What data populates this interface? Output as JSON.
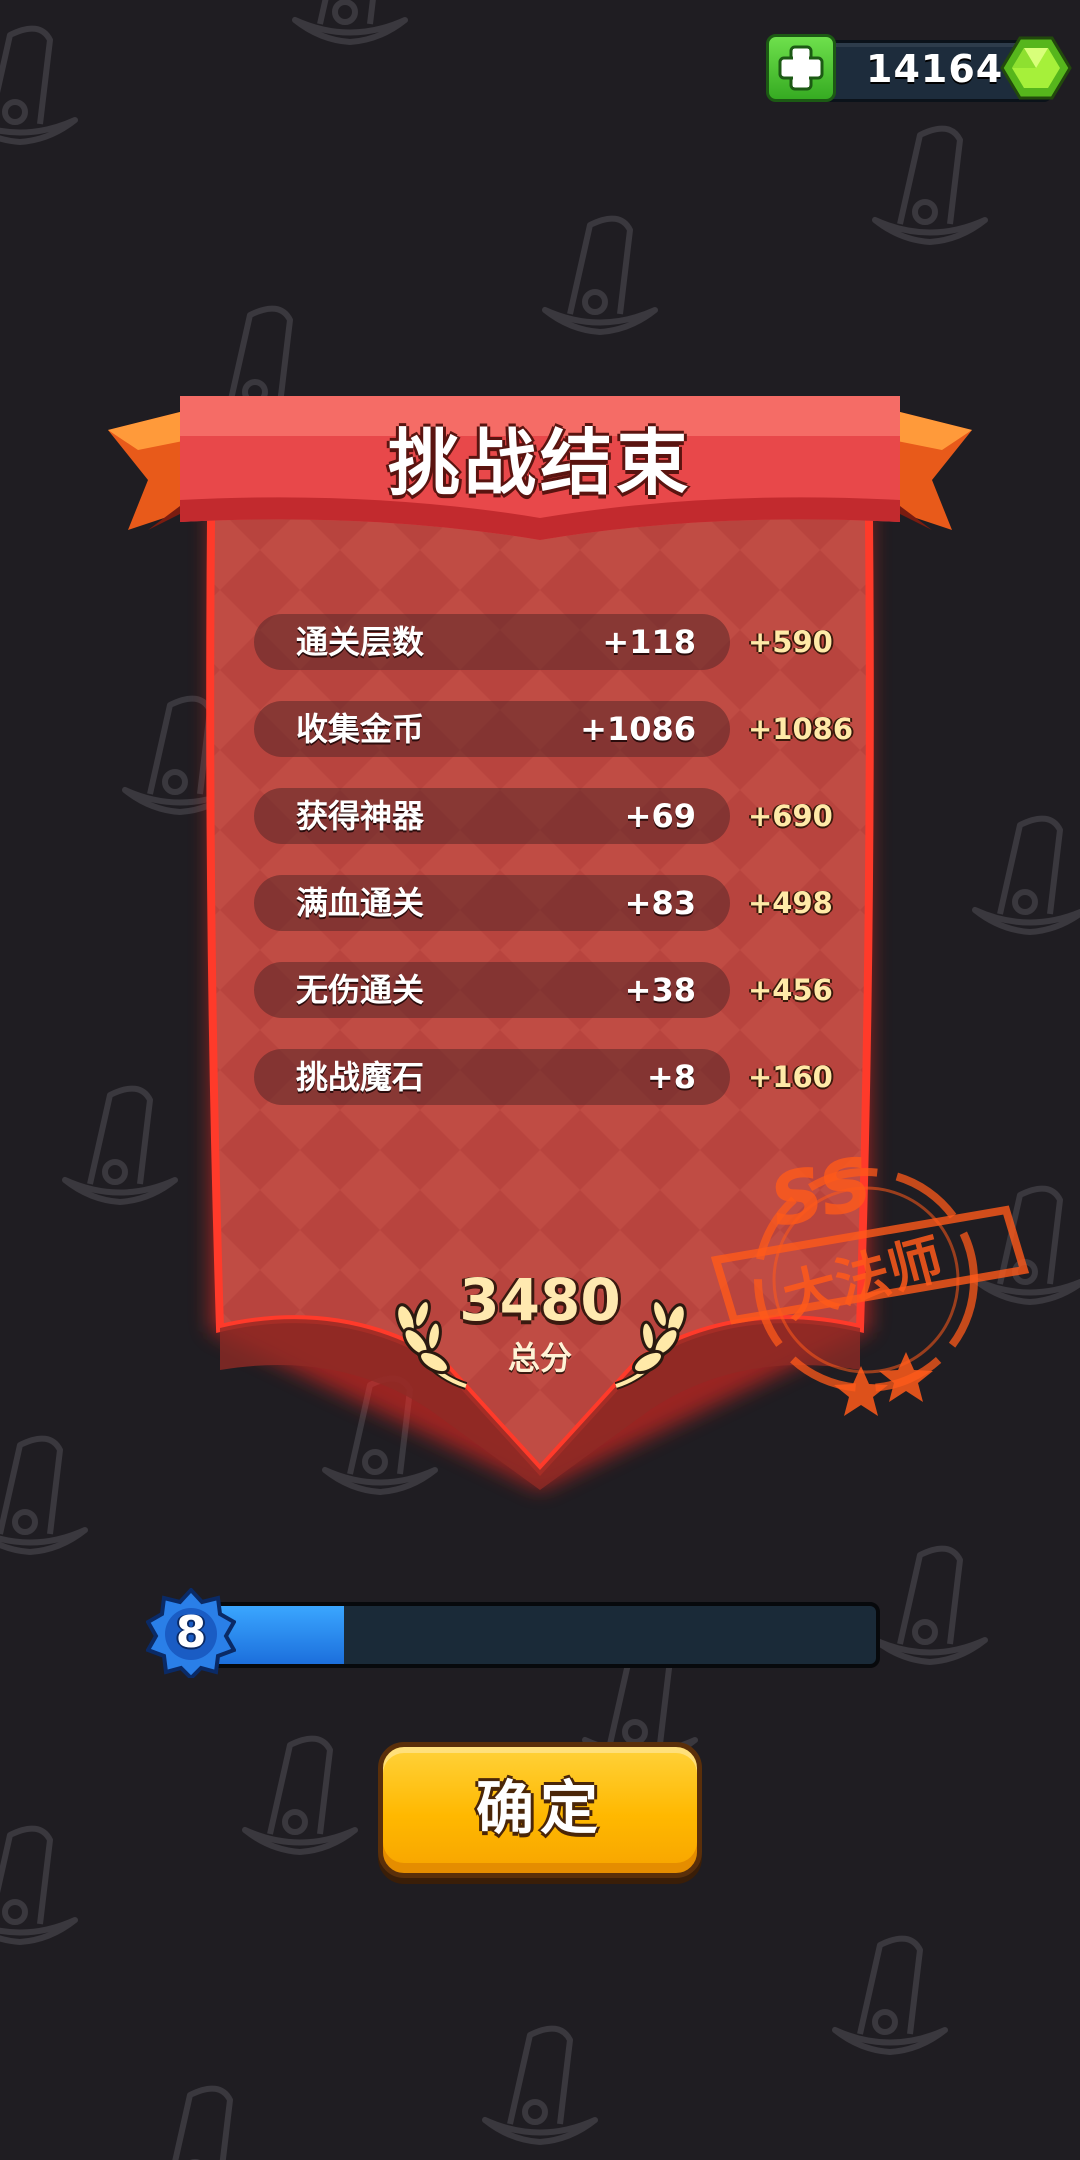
{
  "currency": {
    "gems": "14164"
  },
  "result": {
    "title": "挑战结束",
    "rows": [
      {
        "label": "通关层数",
        "value": "+118",
        "bonus": "+590"
      },
      {
        "label": "收集金币",
        "value": "+1086",
        "bonus": "+1086"
      },
      {
        "label": "获得神器",
        "value": "+69",
        "bonus": "+690"
      },
      {
        "label": "满血通关",
        "value": "+83",
        "bonus": "+498"
      },
      {
        "label": "无伤通关",
        "value": "+38",
        "bonus": "+456"
      },
      {
        "label": "挑战魔石",
        "value": "+8",
        "bonus": "+160"
      }
    ],
    "total_score": "3480",
    "total_label": "总分",
    "rank_grade": "SS",
    "rank_title": "大法师",
    "rank_stars": 2
  },
  "level": {
    "number": "8",
    "progress": 0.22
  },
  "confirm_label": "确定",
  "colors": {
    "background": "#1f1d22",
    "banner": "#e8484a",
    "panel": "#b6403a",
    "stamp": "#ff5a1a",
    "progress": "#2a8cf0",
    "button": "#ffbe14"
  }
}
